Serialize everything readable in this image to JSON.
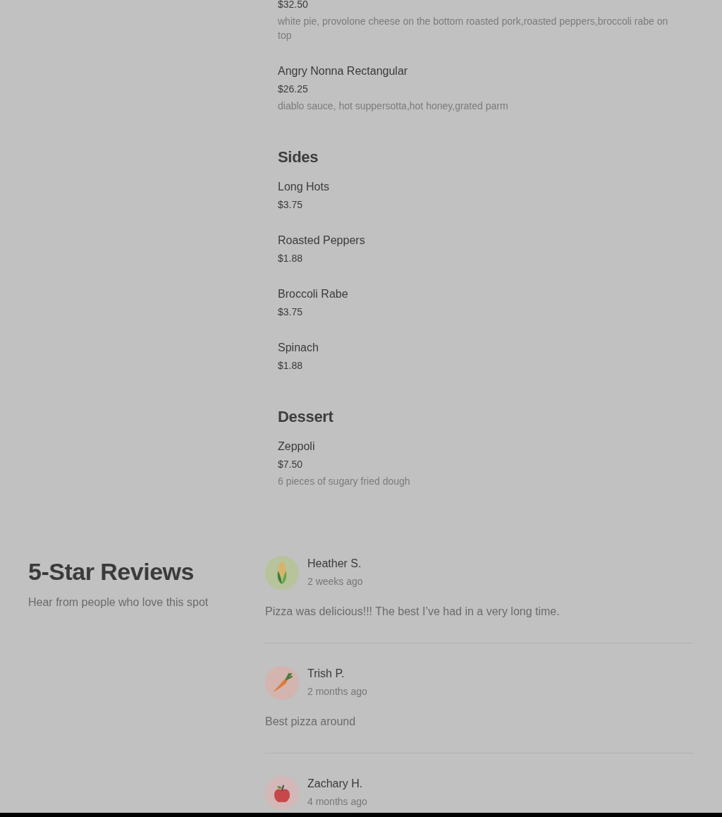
{
  "menu": {
    "sections": [
      {
        "items": [
          {
            "price": "$32.50",
            "description": "white pie, provolone cheese on the bottom roasted pork,roasted peppers,broccoli rabe on top"
          },
          {
            "name": "Angry Nonna Rectangular",
            "price": "$26.25",
            "description": "diablo sauce, hot suppersotta,hot honey,grated parm"
          }
        ]
      },
      {
        "title": "Sides",
        "items": [
          {
            "name": "Long Hots",
            "price": "$3.75"
          },
          {
            "name": "Roasted Peppers",
            "price": "$1.88"
          },
          {
            "name": "Broccoli Rabe",
            "price": "$3.75"
          },
          {
            "name": "Spinach",
            "price": "$1.88"
          }
        ]
      },
      {
        "title": "Dessert",
        "items": [
          {
            "name": "Zeppoli",
            "price": "$7.50",
            "description": "6 pieces of sugary fried dough"
          }
        ]
      }
    ]
  },
  "reviews": {
    "title": "5-Star Reviews",
    "subtitle": "Hear from people who love this spot",
    "items": [
      {
        "name": "Heather S.",
        "time": "2 weeks ago",
        "text": "Pizza was delicious!!! The best I’ve had in a very long time."
      },
      {
        "name": "Trish P.",
        "time": "2 months ago",
        "text": "Best pizza around"
      },
      {
        "name": "Zachary H.",
        "time": "4 months ago"
      }
    ]
  }
}
